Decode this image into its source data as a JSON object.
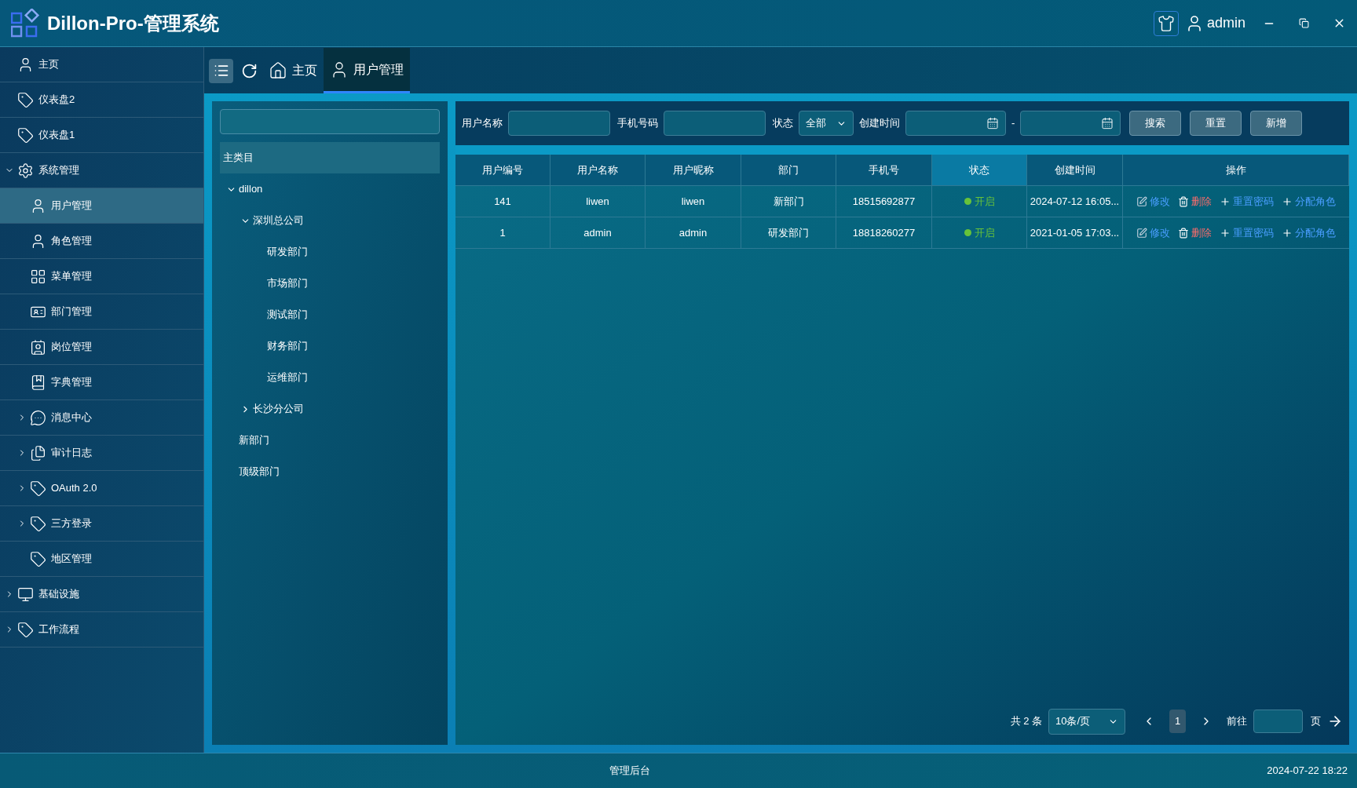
{
  "header": {
    "title": "Dillon-Pro-管理系统",
    "user": "admin"
  },
  "sidebar": {
    "items": [
      {
        "label": "主页",
        "selected": false
      },
      {
        "label": "仪表盘2",
        "selected": false
      },
      {
        "label": "仪表盘1",
        "selected": false
      },
      {
        "label": "系统管理",
        "selected": false,
        "expanded": true,
        "children": [
          {
            "label": "用户管理",
            "selected": true
          },
          {
            "label": "角色管理",
            "selected": false
          },
          {
            "label": "菜单管理",
            "selected": false
          },
          {
            "label": "部门管理",
            "selected": false
          },
          {
            "label": "岗位管理",
            "selected": false
          },
          {
            "label": "字典管理",
            "selected": false
          },
          {
            "label": "消息中心",
            "selected": false,
            "expanded": false
          },
          {
            "label": "审计日志",
            "selected": false,
            "expanded": false
          },
          {
            "label": "OAuth 2.0",
            "selected": false,
            "expanded": false
          },
          {
            "label": "三方登录",
            "selected": false,
            "expanded": false
          },
          {
            "label": "地区管理",
            "selected": false
          }
        ]
      },
      {
        "label": "基础设施",
        "selected": false,
        "expanded": false
      },
      {
        "label": "工作流程",
        "selected": false,
        "expanded": false
      }
    ]
  },
  "tabs": [
    {
      "label": "主页",
      "selected": false
    },
    {
      "label": "用户管理",
      "selected": true
    }
  ],
  "dept_tree": {
    "root": {
      "label": "主类目",
      "selected": true
    },
    "nodes": [
      {
        "label": "dillon",
        "expanded": true,
        "children": [
          {
            "label": "深圳总公司",
            "expanded": true,
            "children": [
              {
                "label": "研发部门"
              },
              {
                "label": "市场部门"
              },
              {
                "label": "测试部门"
              },
              {
                "label": "财务部门"
              },
              {
                "label": "运维部门"
              }
            ]
          },
          {
            "label": "长沙分公司",
            "expanded": false
          }
        ]
      },
      {
        "label": "新部门"
      },
      {
        "label": "顶级部门"
      }
    ]
  },
  "filters": {
    "username_label": "用户名称",
    "phone_label": "手机号码",
    "status_label": "状态",
    "status_value": "全部",
    "created_label": "创建时间",
    "range_separator": "-",
    "buttons": [
      "搜索",
      "重置",
      "新增"
    ]
  },
  "table": {
    "columns": [
      {
        "label": "用户编号",
        "selected": false
      },
      {
        "label": "用户名称",
        "selected": false
      },
      {
        "label": "用户昵称",
        "selected": false
      },
      {
        "label": "部门",
        "selected": false
      },
      {
        "label": "手机号",
        "selected": false
      },
      {
        "label": "状态",
        "selected": true
      },
      {
        "label": "创建时间",
        "selected": false
      },
      {
        "label": "操作",
        "selected": false
      }
    ],
    "rows": [
      {
        "cells": [
          "141",
          "liwen",
          "liwen",
          "新部门",
          "18515692877"
        ],
        "status": "开启",
        "color": "#67c23a",
        "created": "2024-07-12 16:05...",
        "actions": [
          {
            "kind": "edit",
            "label": "修改"
          },
          {
            "kind": "delete",
            "label": "删除"
          },
          {
            "kind": "add",
            "label": "重置密码"
          },
          {
            "kind": "add",
            "label": "分配角色"
          }
        ]
      },
      {
        "cells": [
          "1",
          "admin",
          "admin",
          "研发部门",
          "18818260277"
        ],
        "status": "开启",
        "color": "#67c23a",
        "created": "2021-01-05 17:03...",
        "actions": [
          {
            "kind": "edit",
            "label": "修改"
          },
          {
            "kind": "delete",
            "label": "删除"
          },
          {
            "kind": "add",
            "label": "重置密码"
          },
          {
            "kind": "add",
            "label": "分配角色"
          }
        ]
      }
    ]
  },
  "pagination": {
    "total": "共 2 条",
    "page_size": "10条/页",
    "pages": [
      {
        "label": "1",
        "selected": true
      }
    ],
    "goto": "前往",
    "page_unit": "页"
  },
  "footer": {
    "center": "管理后台",
    "datetime": "2024-07-22 18:22"
  }
}
